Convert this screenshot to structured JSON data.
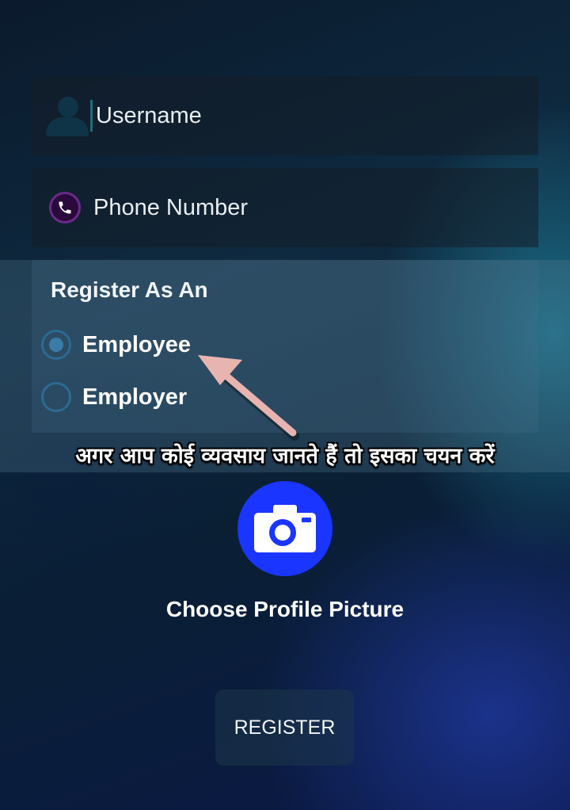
{
  "form": {
    "username_placeholder": "Username",
    "phone_placeholder": "Phone Number"
  },
  "register_as": {
    "title": "Register As An",
    "options": [
      {
        "label": "Employee",
        "selected": true
      },
      {
        "label": "Employer",
        "selected": false
      }
    ]
  },
  "annotation": {
    "hindi_text": "अगर आप कोई व्यवसाय जानते हैं तो इसका चयन करें"
  },
  "profile": {
    "choose_label": "Choose Profile Picture",
    "icon": "camera-icon"
  },
  "actions": {
    "register_label": "REGISTER"
  },
  "colors": {
    "camera_button": "#1a35ff",
    "radio_accent": "#3a7ca6",
    "arrow": "#e8b4b0"
  }
}
